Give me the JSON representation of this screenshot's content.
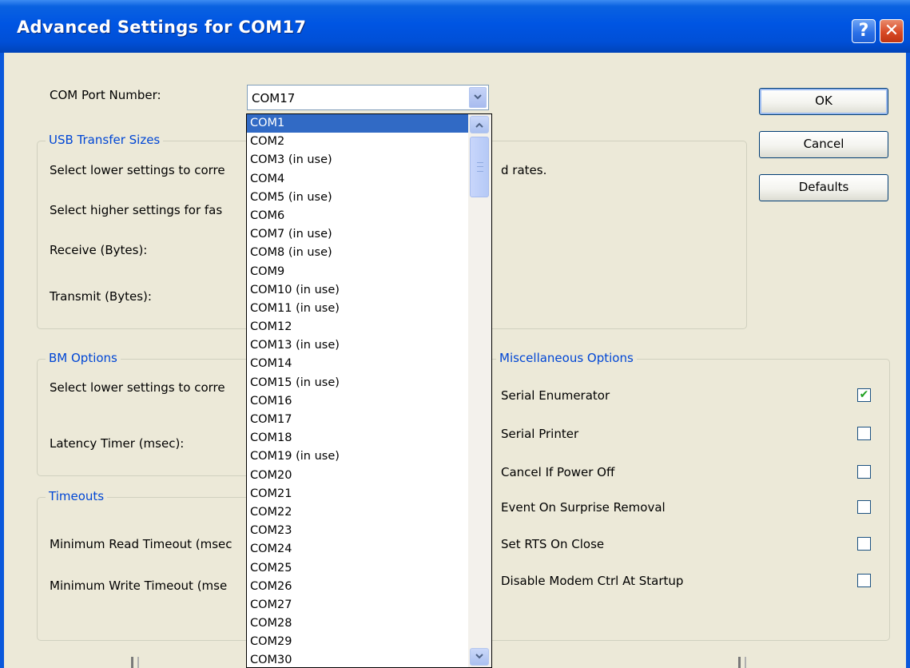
{
  "window": {
    "title": "Advanced Settings for COM17",
    "help_glyph": "?",
    "close_glyph": "✕"
  },
  "com_port": {
    "label": "COM Port Number:",
    "value": "COM17",
    "options": [
      "COM1",
      "COM2",
      "COM3 (in use)",
      "COM4",
      "COM5 (in use)",
      "COM6",
      "COM7 (in use)",
      "COM8 (in use)",
      "COM9",
      "COM10 (in use)",
      "COM11 (in use)",
      "COM12",
      "COM13 (in use)",
      "COM14",
      "COM15 (in use)",
      "COM16",
      "COM17",
      "COM18",
      "COM19 (in use)",
      "COM20",
      "COM21",
      "COM22",
      "COM23",
      "COM24",
      "COM25",
      "COM26",
      "COM27",
      "COM28",
      "COM29",
      "COM30"
    ],
    "highlighted": "COM1"
  },
  "buttons": {
    "ok": "OK",
    "cancel": "Cancel",
    "defaults": "Defaults"
  },
  "usb": {
    "legend": "USB Transfer Sizes",
    "line1_start": "Select lower settings to corre",
    "line1_end": "d rates.",
    "line2": "Select higher settings for fas",
    "receive": "Receive (Bytes):",
    "transmit": "Transmit (Bytes):"
  },
  "bm": {
    "legend": "BM Options",
    "line1": "Select lower settings to corre",
    "latency": "Latency Timer (msec):"
  },
  "timeouts": {
    "legend": "Timeouts",
    "read": "Minimum Read Timeout (msec",
    "write": "Minimum Write Timeout (mse"
  },
  "misc": {
    "legend": "Miscellaneous Options",
    "items": [
      {
        "label": "Serial Enumerator",
        "checked": true
      },
      {
        "label": "Serial Printer",
        "checked": false
      },
      {
        "label": "Cancel If Power Off",
        "checked": false
      },
      {
        "label": "Event On Surprise Removal",
        "checked": false
      },
      {
        "label": "Set RTS On Close",
        "checked": false
      },
      {
        "label": "Disable Modem Ctrl At Startup",
        "checked": false
      }
    ]
  },
  "colors": {
    "title_blue": "#0055e3",
    "legend_blue": "#0046d5",
    "face": "#ece9d8",
    "selection": "#316ac5"
  }
}
